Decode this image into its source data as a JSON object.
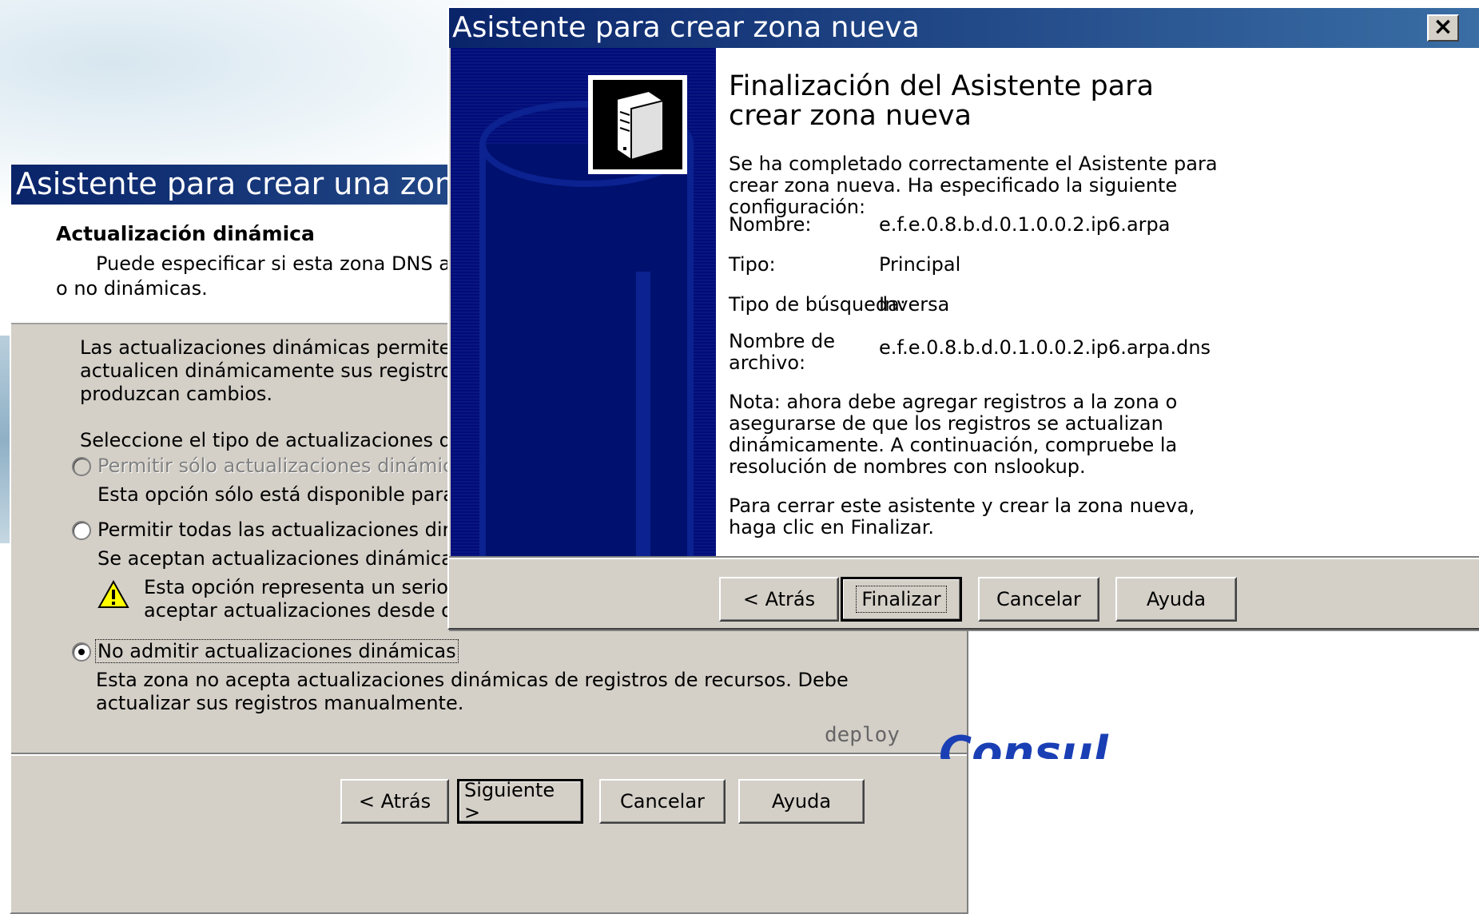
{
  "back_dialog": {
    "title": "Asistente para crear una zona nueva",
    "header_title": "Actualización dinámica",
    "header_sub_1": "Puede especificar si esta zona DNS aceptará actualizaciones seguras, no seguras",
    "header_sub_2": "o no dinámicas.",
    "intro_1": "Las actualizaciones dinámicas permiten que los equipos cliente DNS registren y",
    "intro_2": "actualicen dinámicamente sus registros de recursos con un servidor DNS cuando se",
    "intro_3": "produzcan cambios.",
    "select_prompt": "Seleccione el tipo de actualizaciones dinámicas que desea permitir:",
    "options": [
      {
        "label": "Permitir sólo actualizaciones dinámicas seguras (recomendado para Active Directory)",
        "desc": "Esta opción sólo está disponible para las zonas integradas en Active Directory.",
        "enabled": false,
        "selected": false
      },
      {
        "label": "Permitir todas las actualizaciones dinámicas (seguras y no seguras)",
        "desc": "Se aceptan actualizaciones dinámicas de registros de recursos desde cualquier cliente.",
        "warning_1": "Esta opción representa un serio peligro para la seguridad porque permite",
        "warning_2": "aceptar actualizaciones desde orígenes que no son de confianza.",
        "enabled": true,
        "selected": false
      },
      {
        "label": "No admitir actualizaciones dinámicas",
        "desc_1": "Esta zona no acepta actualizaciones dinámicas de registros de recursos. Debe",
        "desc_2": "actualizar sus registros manualmente.",
        "enabled": true,
        "selected": true
      }
    ],
    "buttons": {
      "back": "< Atrás",
      "next": "Siguiente >",
      "cancel": "Cancelar",
      "help": "Ayuda"
    }
  },
  "front_dialog": {
    "title": "Asistente para crear zona nueva",
    "close_label": "×",
    "heading": "Finalización del Asistente para crear zona nueva",
    "intro": "Se ha completado correctamente el Asistente para crear zona nueva. Ha especificado la siguiente configuración:",
    "fields": {
      "name_label": "Nombre:",
      "name_value": "e.f.e.0.8.b.d.0.1.0.0.2.ip6.arpa",
      "type_label": "Tipo:",
      "type_value": "Principal",
      "lookup_label": "Tipo de búsqueda:",
      "lookup_value": "Inversa",
      "file_label_1": "Nombre de",
      "file_label_2": "archivo:",
      "file_value": "e.f.e.0.8.b.d.0.1.0.0.2.ip6.arpa.dns"
    },
    "note": "Nota: ahora debe agregar registros a la zona o asegurarse de que los registros se actualizan dinámicamente. A continuación, compruebe la resolución de nombres con nslookup.",
    "closing": "Para cerrar este asistente y crear la zona nueva, haga clic en Finalizar.",
    "buttons": {
      "back": "< Atrás",
      "finish": "Finalizar",
      "cancel": "Cancelar",
      "help": "Ayuda"
    }
  },
  "logos": {
    "deploy": "deploy",
    "consul": "Consul"
  }
}
